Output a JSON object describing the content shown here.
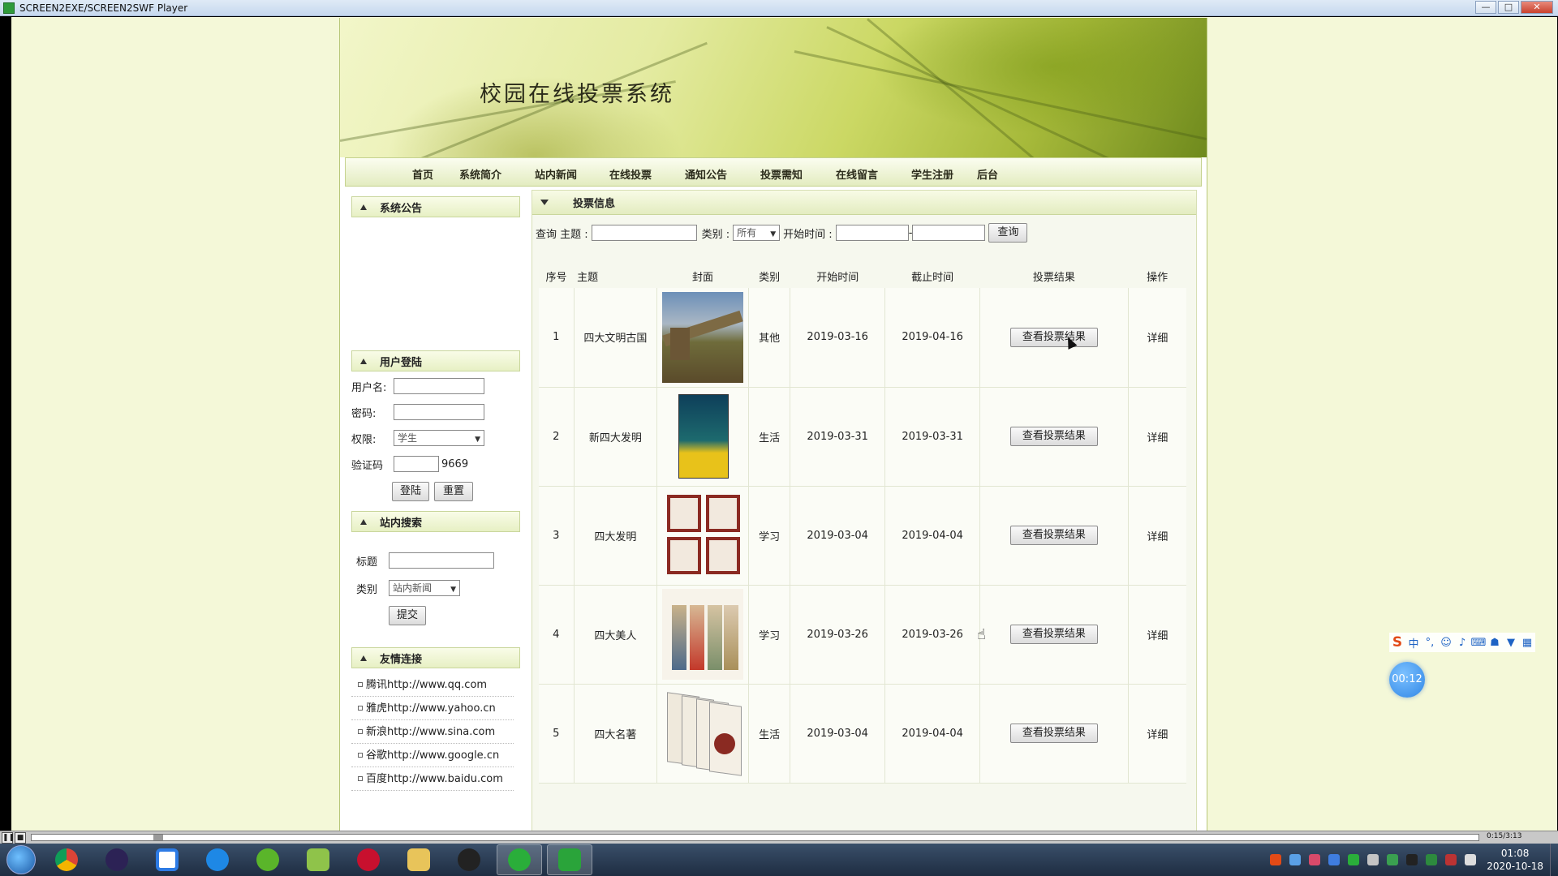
{
  "window": {
    "title": "SCREEN2EXE/SCREEN2SWF Player",
    "btn_min": "—",
    "btn_max": "□",
    "btn_close": "✕"
  },
  "site": {
    "title": "校园在线投票系统",
    "nav": [
      "首页",
      "系统简介",
      "站内新闻",
      "在线投票",
      "通知公告",
      "投票需知",
      "在线留言",
      "学生注册",
      "后台"
    ]
  },
  "sidebar": {
    "announcement": {
      "title": "系统公告"
    },
    "login": {
      "title": "用户登陆",
      "username_label": "用户名:",
      "password_label": "密码:",
      "role_label": "权限:",
      "role_value": "学生",
      "captcha_label": "验证码",
      "captcha_code": "9669",
      "login_btn": "登陆",
      "reset_btn": "重置"
    },
    "search": {
      "title": "站内搜索",
      "title_label": "标题",
      "category_label": "类别",
      "category_value": "站内新闻",
      "submit_btn": "提交"
    },
    "links": {
      "title": "友情连接",
      "items": [
        "腾讯http://www.qq.com",
        "雅虎http://www.yahoo.cn",
        "新浪http://www.sina.com",
        "谷歌http://www.google.cn",
        "百度http://www.baidu.com"
      ]
    }
  },
  "content": {
    "title": "投票信息",
    "query": {
      "label": "查询 主题 :",
      "category_label": "类别 :",
      "category_value": "所有",
      "start_label": "开始时间 :",
      "dash": "-",
      "button": "查询"
    },
    "table": {
      "headers": [
        "序号",
        "主题",
        "封面",
        "类别",
        "开始时间",
        "截止时间",
        "投票结果",
        "操作"
      ],
      "rows": [
        {
          "no": "1",
          "topic": "四大文明古国",
          "category": "其他",
          "start": "2019-03-16",
          "end": "2019-04-16",
          "result_btn": "查看投票结果",
          "action": "详细"
        },
        {
          "no": "2",
          "topic": "新四大发明",
          "category": "生活",
          "start": "2019-03-31",
          "end": "2019-03-31",
          "result_btn": "查看投票结果",
          "action": "详细"
        },
        {
          "no": "3",
          "topic": "四大发明",
          "category": "学习",
          "start": "2019-03-04",
          "end": "2019-04-04",
          "result_btn": "查看投票结果",
          "action": "详细"
        },
        {
          "no": "4",
          "topic": "四大美人",
          "category": "学习",
          "start": "2019-03-26",
          "end": "2019-03-26",
          "result_btn": "查看投票结果",
          "action": "详细"
        },
        {
          "no": "5",
          "topic": "四大名著",
          "category": "生活",
          "start": "2019-03-04",
          "end": "2019-04-04",
          "result_btn": "查看投票结果",
          "action": "详细"
        }
      ]
    }
  },
  "player": {
    "time": "0:15/3:13"
  },
  "ime": {
    "logo": "S",
    "mode": "中",
    "punct": "°,",
    "emoji": "☺",
    "mic": "♪",
    "kbd": "⌨",
    "user": "☗",
    "shirt": "▼",
    "grid": "▦"
  },
  "timer": "00:12",
  "clock": {
    "time": "01:08",
    "date": "2020-10-18"
  },
  "colors": {
    "accent": "#b8c77a",
    "page_bg": "#f4f8d8",
    "header_bg": "#e3ecc0"
  }
}
